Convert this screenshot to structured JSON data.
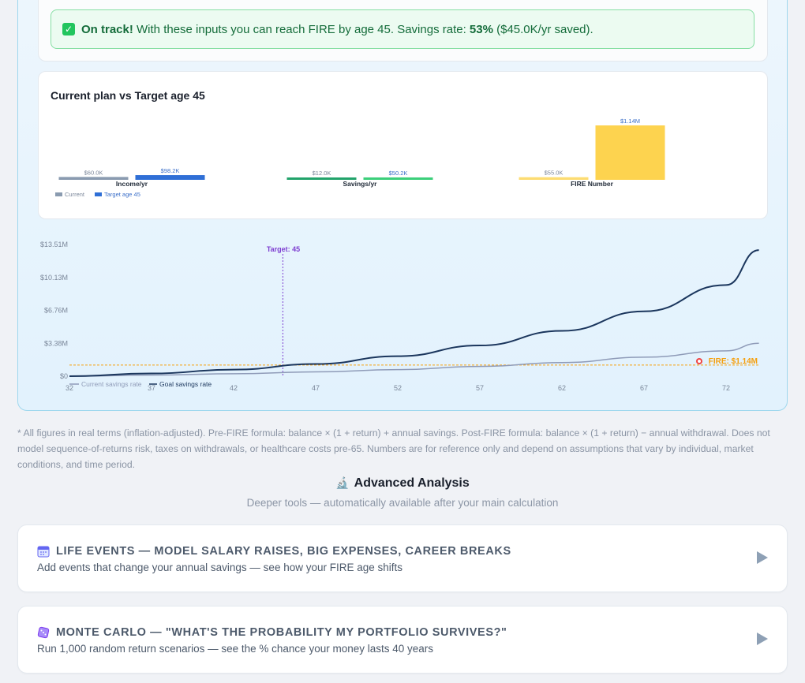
{
  "status": {
    "ontrack_label": "On track!",
    "message_pre": " With these inputs you can reach FIRE by age 45. Savings rate: ",
    "rate": "53%",
    "message_post": " ($45.0K/yr saved)."
  },
  "compare": {
    "title": "Current plan vs Target age 45"
  },
  "growth": {
    "target_label": "Target: 45",
    "fire_label": "FIRE: $1.14M",
    "legend_current": "Current savings rate",
    "legend_goal": "Goal savings rate"
  },
  "footnote": "* All figures in real terms (inflation-adjusted). Pre-FIRE formula: balance × (1 + return) + annual savings. Post-FIRE formula: balance × (1 + return) − annual withdrawal. Does not model sequence-of-returns risk, taxes on withdrawals, or healthcare costs pre-65. Numbers are for reference only and depend on assumptions that vary by individual, market conditions, and time period.",
  "advanced": {
    "title": "Advanced Analysis",
    "subtitle": "Deeper tools — automatically available after your main calculation",
    "life_events": {
      "title": "LIFE EVENTS — MODEL SALARY RAISES, BIG EXPENSES, CAREER BREAKS",
      "desc": "Add events that change your annual savings — see how your FIRE age shifts",
      "icon": "calendar-icon"
    },
    "monte_carlo": {
      "title": "MONTE CARLO — \"WHAT'S THE PROBABILITY MY PORTFOLIO SURVIVES?\"",
      "desc": "Run 1,000 random return scenarios — see the % chance your money lasts 40 years",
      "icon": "dice-icon"
    }
  },
  "colors": {
    "current_bar": "#8a9bb0",
    "target_bar": "#2f6fd6",
    "savings_current": "#22a36b",
    "savings_target": "#3ccf7a",
    "fire_bar": "#fdd34f",
    "goal_line": "#1b365d",
    "current_line": "#8f9bb8",
    "target_line": "#7e3fd1",
    "fire_line": "#f59e0b"
  },
  "chart_data": [
    {
      "type": "bar",
      "title": "Current plan vs Target age 45",
      "categories": [
        "Income/yr",
        "Savings/yr",
        "FIRE Number"
      ],
      "series": [
        {
          "name": "Current",
          "values": [
            60.0,
            12.0,
            55.0
          ],
          "labels": [
            "$60.0K",
            "$12.0K",
            "$55.0K"
          ]
        },
        {
          "name": "Target age 45",
          "values": [
            98.2,
            50.2,
            1140
          ],
          "labels": [
            "$98.2K",
            "$50.2K",
            "$1.14M"
          ]
        }
      ],
      "legend": "bottom-left",
      "unit": "K"
    },
    {
      "type": "line",
      "x": [
        32,
        37,
        42,
        47,
        52,
        57,
        62,
        67,
        72
      ],
      "x_ticks": [
        "32",
        "37",
        "42",
        "47",
        "52",
        "57",
        "62",
        "67",
        "72"
      ],
      "y_ticks": [
        "$0",
        "$3.38M",
        "$6.76M",
        "$10.13M",
        "$13.51M"
      ],
      "ylim": [
        0,
        13.51
      ],
      "xlim": [
        32,
        74
      ],
      "series": [
        {
          "name": "Current savings rate",
          "values": [
            0,
            0.11,
            0.25,
            0.44,
            0.68,
            1.0,
            1.4,
            1.95,
            2.6,
            3.38
          ]
        },
        {
          "name": "Goal savings rate",
          "values": [
            0,
            0.28,
            0.68,
            1.25,
            2.05,
            3.15,
            4.65,
            6.65,
            9.35,
            12.93
          ]
        }
      ],
      "series_x": [
        32,
        37,
        42,
        47,
        52,
        57,
        62,
        67,
        72,
        74
      ],
      "markers": {
        "target_age": 45,
        "fire_number": 1.14
      },
      "grid": false,
      "legend": "bottom-left"
    }
  ]
}
